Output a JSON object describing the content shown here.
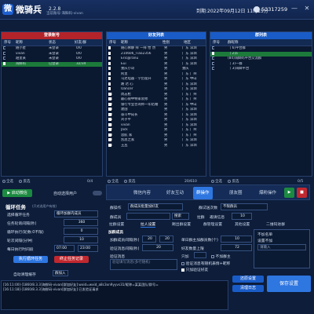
{
  "app": {
    "title": "微骑兵",
    "version": "2.2.8",
    "subtitle": "当前账号:海鲜码-vivan",
    "expire": "到期:2022年09月12日 11时15分",
    "uid": "53317259"
  },
  "panels": {
    "account": {
      "title": "登录账号",
      "headers": [
        "序号",
        "昵称",
        "状态",
        "好友/群"
      ],
      "rows": [
        {
          "no": "1",
          "name": "随小星",
          "status": "未登录",
          "count": "0/0",
          "sel": false
        },
        {
          "no": "2",
          "name": "vivan",
          "status": "未登录",
          "count": "0/0",
          "sel": false
        },
        {
          "no": "3",
          "name": "越里某",
          "status": "未登录",
          "count": "0/0",
          "sel": false
        },
        {
          "no": "4",
          "name": "海鲜码",
          "status": "已登录",
          "count": "32/34",
          "sel": true
        }
      ]
    },
    "friends": {
      "title": "好友列表",
      "headers": [
        "序号",
        "昵称",
        "性别",
        "地区"
      ],
      "rows": [
        {
          "no": "1",
          "name": "随心佛静 拜 一拜 怡 然",
          "sex": "男",
          "area": "广东 深圳"
        },
        {
          "no": "2",
          "name": "210606_Tiao2356",
          "sex": "男",
          "area": "广东 深圳"
        },
        {
          "no": "3",
          "name": "Eric@ranu",
          "sex": "男",
          "area": "广东 深圳"
        },
        {
          "no": "4",
          "name": "Eui",
          "sex": "男",
          "area": "广东 深圳"
        },
        {
          "no": "5",
          "name": "重庆小哥",
          "sex": "男",
          "area": "重庆"
        },
        {
          "no": "6",
          "name": "阿里",
          "sex": "男",
          "area": "广东 广州"
        },
        {
          "no": "7",
          "name": "马达电器 - 学历提升",
          "sex": "男",
          "area": "广东 中山"
        },
        {
          "no": "8",
          "name": "路 达 心",
          "sex": "男",
          "area": "广东 深圳"
        },
        {
          "no": "9",
          "name": "Oancer",
          "sex": "男",
          "area": "广东 深圳"
        },
        {
          "no": "10",
          "name": "周志枪",
          "sex": "男",
          "area": "广东 广州"
        },
        {
          "no": "11",
          "name": "最心很中特家装修",
          "sex": "男",
          "area": "广东 广州"
        },
        {
          "no": "12",
          "name": "银行专业咨询师一年结婚",
          "sex": "男",
          "area": "广东 中山"
        },
        {
          "no": "13",
          "name": "建国",
          "sex": "男",
          "area": "广东 深圳"
        },
        {
          "no": "14",
          "name": "奋斗中成长",
          "sex": "男",
          "area": "广东 深圳"
        },
        {
          "no": "15",
          "name": "刘子平",
          "sex": "男",
          "area": "广东 深圳"
        },
        {
          "no": "16",
          "name": "vivan",
          "sex": "男",
          "area": "广东 深圳"
        },
        {
          "no": "17",
          "name": "Jack",
          "sex": "男",
          "area": "广东 广州"
        },
        {
          "no": "18",
          "name": "思航 家",
          "sex": "男",
          "area": "广东 广州"
        },
        {
          "no": "19",
          "name": "凯思之家",
          "sex": "男",
          "area": "广东 深圳"
        },
        {
          "no": "20",
          "name": "王丛",
          "sex": "男",
          "area": "广东 深圳"
        }
      ]
    },
    "groups": {
      "title": "群列表",
      "headers": [
        "序号",
        "群昵称"
      ],
      "rows": [
        {
          "no": "1",
          "name": "（  6)平台群",
          "sel": false
        },
        {
          "no": "2",
          "name": "（  2)a",
          "sel": true
        },
        {
          "no": "3",
          "name": "(84)海鲜码平台交流群",
          "sel": false
        },
        {
          "no": "4",
          "name": "（  3)一群",
          "sel": false
        },
        {
          "no": "5",
          "name": "（  3)海鲜平台",
          "sel": false
        }
      ]
    }
  },
  "filters": {
    "all": "全选",
    "invert": "反选",
    "count_left": "0/4",
    "count_mid": "20/610",
    "count_right": "0/5"
  },
  "toolbar": {
    "start": "启动微信",
    "auto_select": "自动选择用户",
    "tabs": [
      "微信内容",
      "好友互动",
      "群操作",
      "朋友圈",
      "爆粉操作"
    ]
  },
  "task": {
    "title": "循环任务",
    "subtitle": "(只对选用户有效)",
    "loop_label": "选择循环任务",
    "loop_value": "循环加群内成员",
    "interval_label": "任务轮询间隔(秒)",
    "interval": "360",
    "runs_label": "循环执行(轮数:0不限)",
    "runs": "0",
    "gap_label": "轮次间隔(分钟)",
    "gap": "10",
    "daily_label": "每日执行时间段",
    "daily_start": "07:00",
    "daily_end": "23:00",
    "exec_btn": "执行循环任务",
    "stop_btn": "终止任务记录",
    "auto_save": "自动清理缓存",
    "notify": "群加入",
    "auto_clear": "自动清理发记录",
    "open_friend": "屏蔽群回复",
    "timing": "操作频繁暂停(分)",
    "timing_val": "10"
  },
  "group": {
    "op_label": "群操作",
    "op_value": "群成员批量加好友",
    "times_label": "群试送次数",
    "times": "不限群员",
    "chat_search": "群成员",
    "search_btn": "搜索",
    "pull": "拉群",
    "invite": "邀请信息",
    "count": "10",
    "tabs": [
      "拉群设置",
      "拉人设置",
      "踢出群设置",
      "群管理设置",
      "其他设置",
      "二维码进群"
    ],
    "add": "加群成员",
    "add_delay_label": "加群成员间隔(秒)",
    "add_delay1": "20",
    "add_delay2": "20",
    "limit_label": "单日群主加群员数(个)",
    "limit": "10",
    "interval_label": "验证消息间隔(秒)",
    "interval": "20",
    "count_label": "好友数量上限",
    "count_val": "72",
    "msg_label": "验证消息",
    "msg_placeholder": "验证填写消息(多行随机)",
    "only_label": "只加",
    "owner": "不加群主",
    "contact": "验证消息有随机表情+昵称",
    "verify": "只加验证好友",
    "filter_title": "不加名单",
    "filter_opt": "设置不加",
    "tags": "请输入"
  },
  "log": {
    "lines": [
      "[16:11:00]-[1860/8.3.3]海鲜码-vivan[群加好友]:wxid=wxid_a8c3xn9yyvs31/昵称=某某团队/群号=",
      "[16:11:18]-[1860/8.3.3]海鲜码-vivan[群加好友]:已发验证请求"
    ],
    "save": "保存设置",
    "clear1": "还原设置",
    "clear2": "清理日志"
  },
  "colors": {
    "bg": "#0d1d3a",
    "accent": "#2e76e0",
    "red": "#b3232a",
    "green": "#1c7a3a"
  }
}
